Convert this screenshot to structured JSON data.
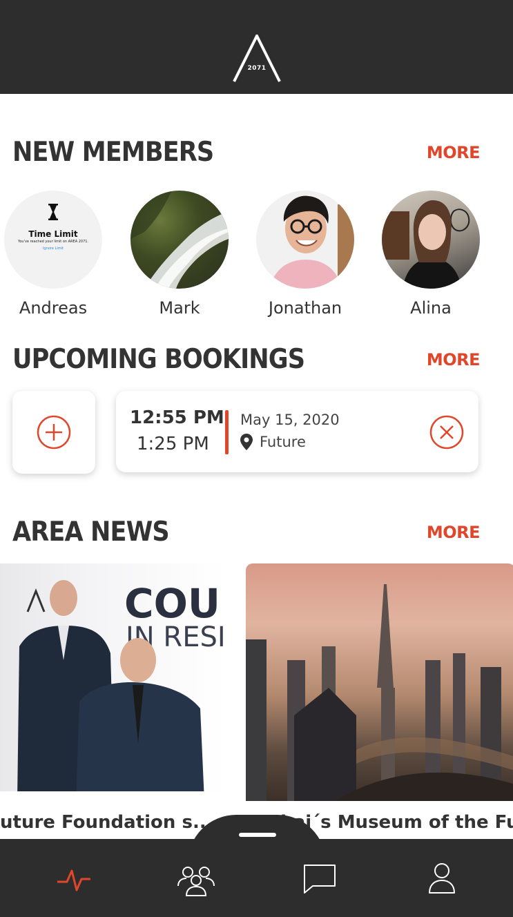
{
  "app": {
    "logo_text": "2071"
  },
  "new_members": {
    "title": "NEW MEMBERS",
    "more": "MORE",
    "members": [
      {
        "name": "Andreas"
      },
      {
        "name": "Mark"
      },
      {
        "name": "Jonathan"
      },
      {
        "name": "Alina"
      }
    ],
    "time_limit": {
      "title": "Time Limit",
      "message": "You've reached your limit on AREA 2071.",
      "link": "Ignore Limit"
    }
  },
  "bookings": {
    "title": "UPCOMING BOOKINGS",
    "more": "MORE",
    "items": [
      {
        "start": "12:55 PM",
        "end": "1:25 PM",
        "date": "May 15, 2020",
        "location": "Future"
      }
    ]
  },
  "news": {
    "title": "AREA NEWS",
    "more": "MORE",
    "articles": [
      {
        "title": "uture Foundation s...",
        "image_text": "COU",
        "image_text2": "IN RESI"
      },
      {
        "title": "Dubai´s Museum of the Fu..."
      }
    ]
  },
  "nav": {
    "items": [
      {
        "icon": "activity-icon",
        "active": true
      },
      {
        "icon": "community-icon",
        "active": false
      },
      {
        "icon": "chat-icon",
        "active": false
      },
      {
        "icon": "profile-icon",
        "active": false
      }
    ]
  },
  "colors": {
    "accent": "#e0462a",
    "dark": "#2d2d2d",
    "text": "#333333"
  }
}
